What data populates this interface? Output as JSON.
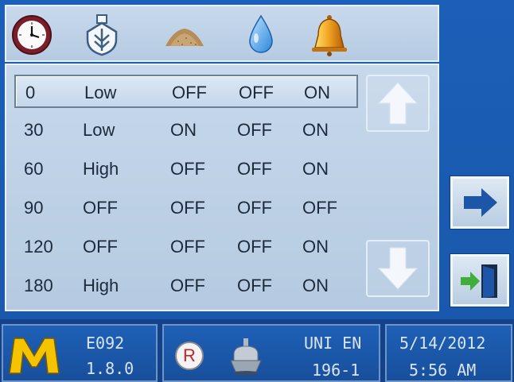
{
  "header": {
    "icons": [
      "clock-icon",
      "spreader-icon",
      "sand-pile-icon",
      "water-drop-icon",
      "bell-icon"
    ]
  },
  "table": {
    "rows": [
      {
        "c0": "0",
        "c1": "Low",
        "c2": "OFF",
        "c3": "OFF",
        "c4": "ON",
        "selected": true
      },
      {
        "c0": "30",
        "c1": "Low",
        "c2": "ON",
        "c3": "OFF",
        "c4": "ON"
      },
      {
        "c0": "60",
        "c1": "High",
        "c2": "OFF",
        "c3": "OFF",
        "c4": "ON"
      },
      {
        "c0": "90",
        "c1": "OFF",
        "c2": "OFF",
        "c3": "OFF",
        "c4": "OFF"
      },
      {
        "c0": "120",
        "c1": "OFF",
        "c2": "OFF",
        "c3": "OFF",
        "c4": "ON"
      },
      {
        "c0": "180",
        "c1": "High",
        "c2": "OFF",
        "c3": "OFF",
        "c4": "ON"
      }
    ]
  },
  "footer": {
    "code": "E092",
    "version": "1.8.0",
    "mode_badge": "R",
    "standard_line1": "UNI EN",
    "standard_line2": "196-1",
    "date": "5/14/2012",
    "time": "5:56 AM"
  },
  "colors": {
    "background": "#1957aa",
    "panel": "#c7d8eb",
    "accent_blue": "#1d56a8",
    "logo_yellow": "#f5c400",
    "badge_red": "#c0262c"
  }
}
